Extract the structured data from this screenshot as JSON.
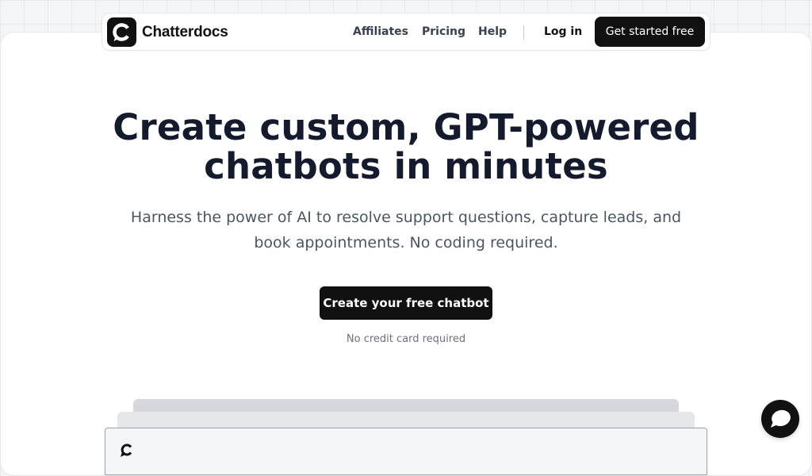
{
  "brand": {
    "name": "Chatterdocs",
    "logo_icon": "chatterdocs-logo-icon"
  },
  "nav": {
    "links": [
      "Affiliates",
      "Pricing",
      "Help"
    ],
    "login": "Log in",
    "cta": "Get started free"
  },
  "hero": {
    "title_line1": "Create custom, GPT-powered",
    "title_line2": "chatbots in minutes",
    "subtitle_line1": "Harness the power of AI to resolve support questions, capture leads, and",
    "subtitle_line2": "book appointments. No coding required.",
    "cta": "Create your free chatbot",
    "note": "No credit card required"
  },
  "preview": {
    "logo_icon": "chatterdocs-logo-icon"
  },
  "chat_widget": {
    "icon": "chat-bubble-icon"
  },
  "colors": {
    "primary": "#111111",
    "heading": "#151b2e",
    "body_text": "#4b5563",
    "muted_text": "#6b7280",
    "background": "#f4f5f7"
  }
}
